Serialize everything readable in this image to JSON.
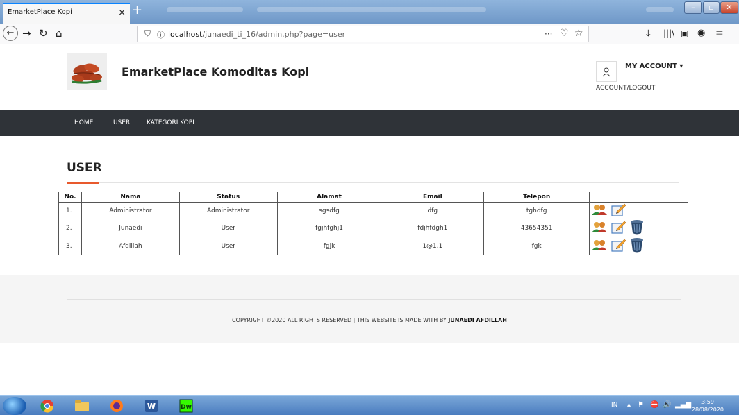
{
  "browser": {
    "tab_title": "EmarketPlace Kopi",
    "tab_close": "×",
    "new_tab": "+",
    "url_host": "localhost",
    "url_path": "/junaedi_ti_16/admin.php?page=user",
    "url_more": "···"
  },
  "header": {
    "site_title": "EmarketPlace Komoditas Kopi",
    "account_title": "MY ACCOUNT ▾",
    "account_sub": "ACCOUNT/LOGOUT"
  },
  "nav": {
    "items": [
      {
        "label": "HOME"
      },
      {
        "label": "USER"
      },
      {
        "label": "KATEGORI KOPI"
      }
    ]
  },
  "content": {
    "title": "USER",
    "table": {
      "headers": [
        "No.",
        "Nama",
        "Status",
        "Alamat",
        "Email",
        "Telepon",
        ""
      ],
      "rows": [
        {
          "no": "1.",
          "nama": "Administrator",
          "status": "Administrator",
          "alamat": "sgsdfg",
          "email": "dfg",
          "telepon": "tghdfg",
          "actions": [
            "user-group-icon",
            "edit-icon"
          ]
        },
        {
          "no": "2.",
          "nama": "Junaedi",
          "status": "User",
          "alamat": "fgjhfghj1",
          "email": "fdjhfdgh1",
          "telepon": "43654351",
          "actions": [
            "user-group-icon",
            "edit-icon",
            "trash-icon"
          ]
        },
        {
          "no": "3.",
          "nama": "Afdillah",
          "status": "User",
          "alamat": "fgjk",
          "email": "1@1.1",
          "telepon": "fgk",
          "actions": [
            "user-group-icon",
            "edit-icon",
            "trash-icon"
          ]
        }
      ]
    }
  },
  "footer": {
    "text": "COPYRIGHT ©2020 ALL RIGHTS RESERVED | THIS WEBSITE IS MADE WITH BY ",
    "author": "JUNAEDI AFDILLAH"
  },
  "taskbar": {
    "lang": "IN",
    "time": "3:59",
    "date": "28/08/2020"
  },
  "colors": {
    "accent": "#e8592d",
    "nav_bg": "#2f3338",
    "footer_bg": "#f5f5f5"
  }
}
